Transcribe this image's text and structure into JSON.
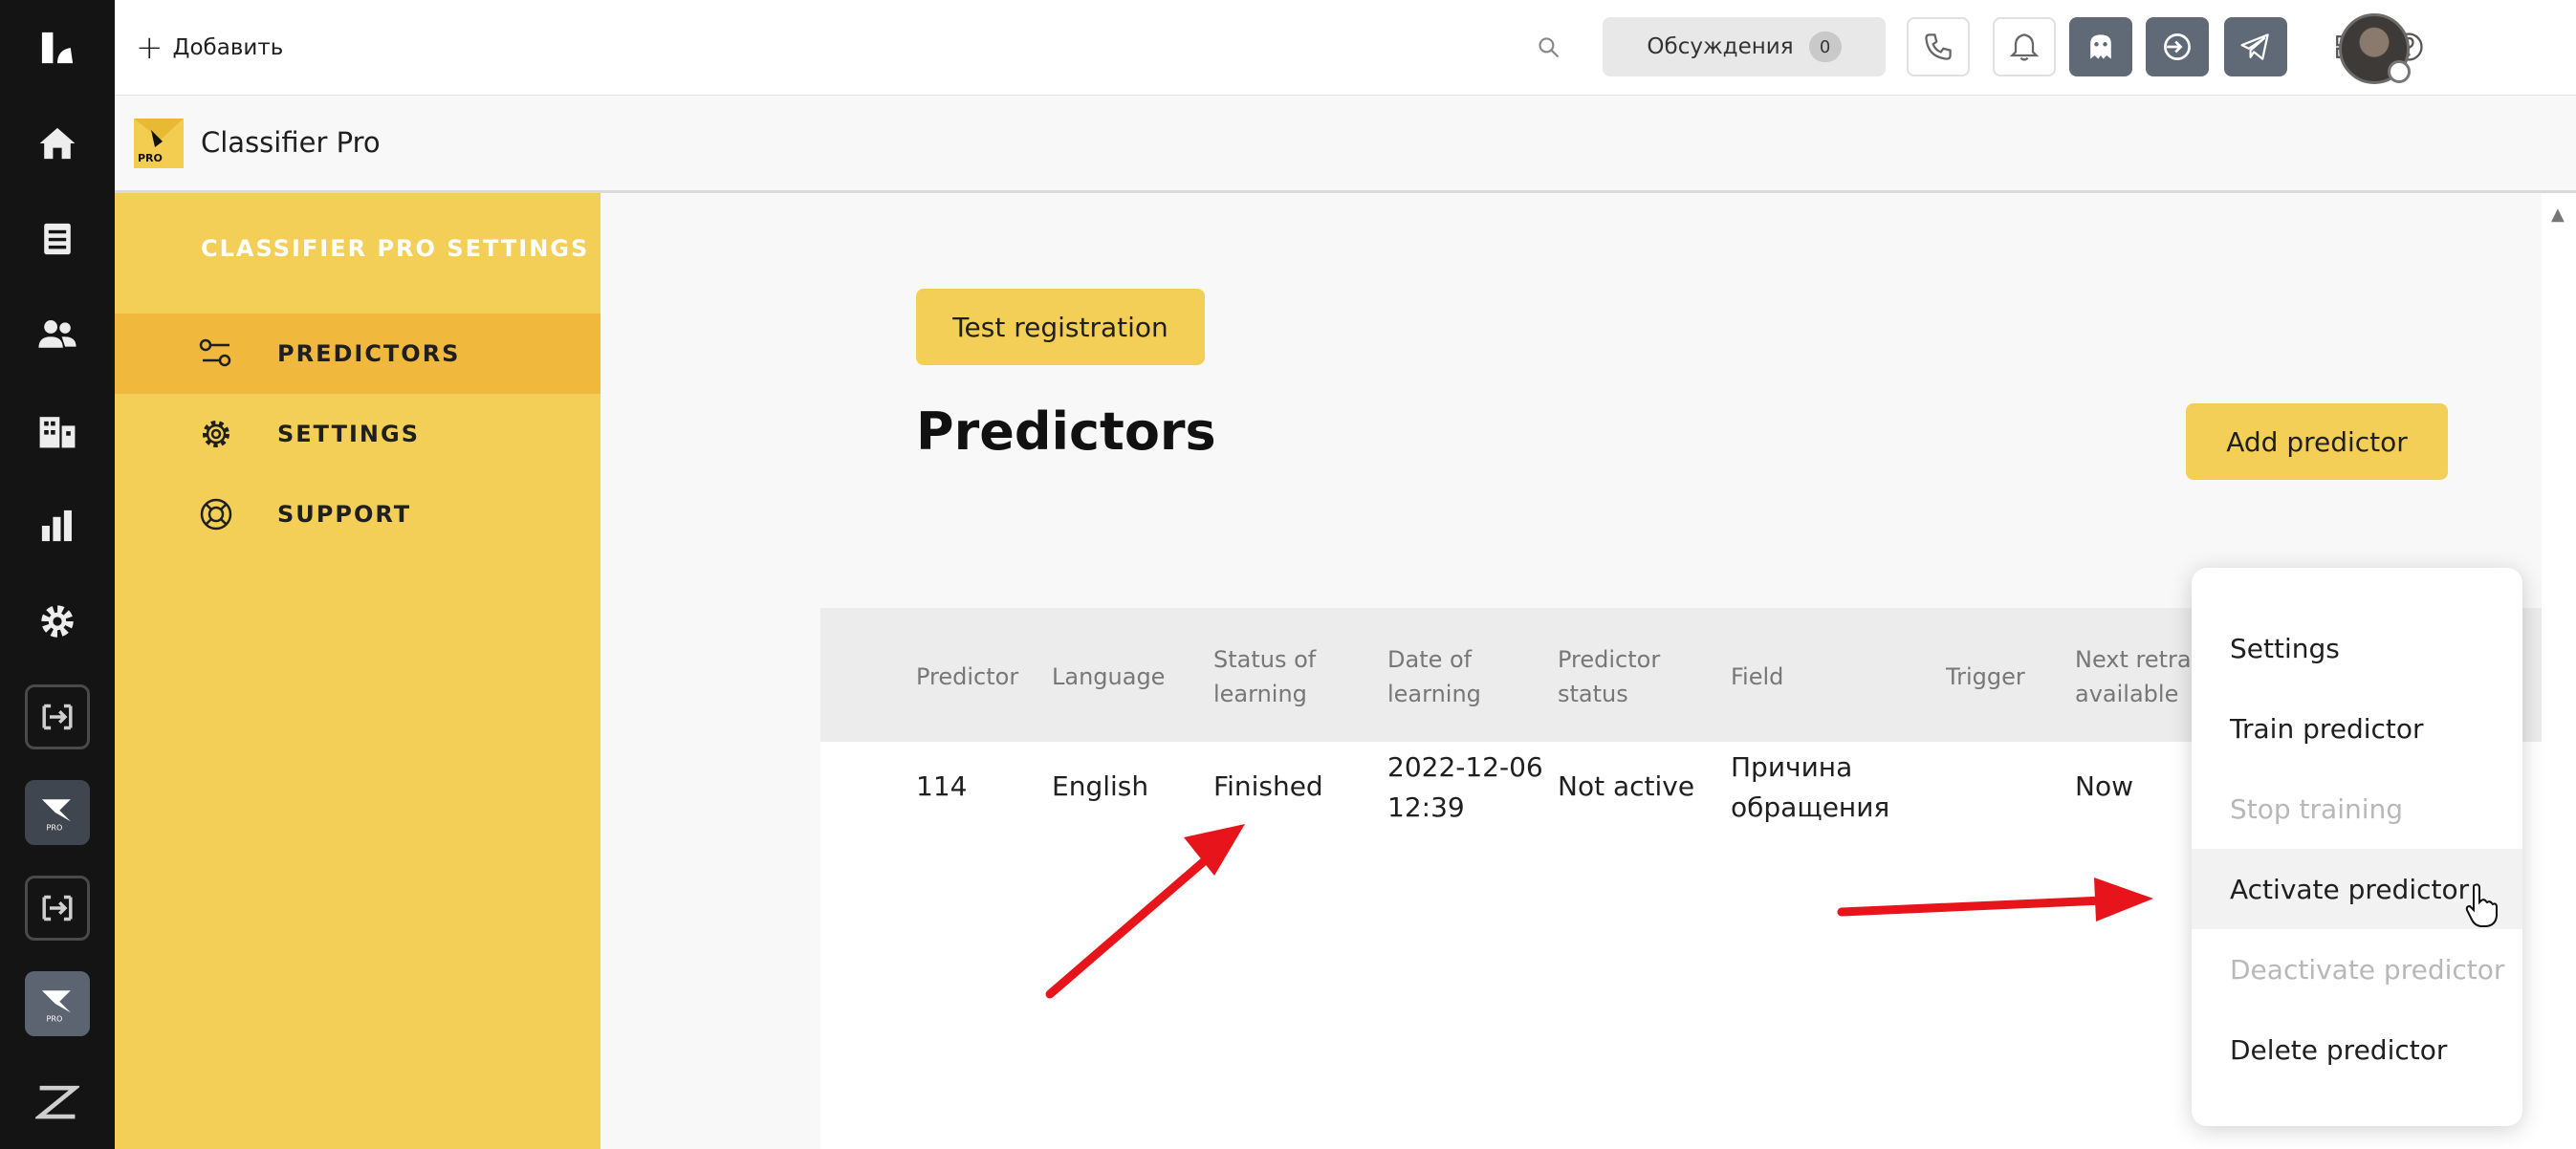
{
  "topbar": {
    "add_label": "Добавить",
    "discussions_label": "Обсуждения",
    "discussions_count": "0"
  },
  "app": {
    "title": "Classifier Pro",
    "logo_text": "PRO"
  },
  "sidebar": {
    "title": "CLASSIFIER PRO SETTINGS",
    "items": [
      {
        "label": "PREDICTORS",
        "icon": "predictors-icon"
      },
      {
        "label": "SETTINGS",
        "icon": "gear-icon"
      },
      {
        "label": "SUPPORT",
        "icon": "lifebuoy-icon"
      }
    ]
  },
  "main": {
    "test_registration_label": "Test registration",
    "heading": "Predictors",
    "add_predictor_label": "Add predictor"
  },
  "table": {
    "headers": [
      "Predictor",
      "Language",
      "Status of\nlearning",
      "Date of\nlearning",
      "Predictor\nstatus",
      "Field",
      "Trigger",
      "Next retrain\navailable"
    ],
    "rows": [
      {
        "predictor": "114",
        "language": "English",
        "status_of_learning": "Finished",
        "date_of_learning": "2022-12-06\n12:39",
        "predictor_status": "Not active",
        "field": "Причина\nобращения",
        "trigger": "",
        "next_retrain": "Now"
      }
    ]
  },
  "menu": {
    "items": [
      {
        "label": "Settings",
        "enabled": true
      },
      {
        "label": "Train predictor",
        "enabled": true
      },
      {
        "label": "Stop training",
        "enabled": false
      },
      {
        "label": "Activate predictor",
        "enabled": true
      },
      {
        "label": "Deactivate predictor",
        "enabled": false
      },
      {
        "label": "Delete predictor",
        "enabled": true
      }
    ]
  },
  "colors": {
    "accent_yellow": "#f4cf57",
    "active_yellow": "#f0b93e",
    "rail": "#141414",
    "annotation_red": "#e8141c"
  }
}
